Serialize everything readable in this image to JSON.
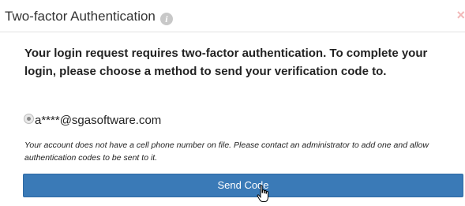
{
  "dialog": {
    "title": "Two-factor Authentication",
    "info_icon": "info-icon",
    "info_glyph": "i",
    "close_icon": "close-icon",
    "close_glyph": "×"
  },
  "body": {
    "message": "Your login request requires two-factor authentication. To complete your login, please choose a method to send your verification code to.",
    "method_option": {
      "label": "a****@sgasoftware.com",
      "selected": true
    },
    "notice": "Your account does not have a cell phone number on file. Please contact an administrator to add one and allow authentication codes to be sent to it.",
    "send_button_label": "Send Code"
  },
  "colors": {
    "button_background": "#3a7ab7",
    "close_icon": "#f2b8b8",
    "info_icon": "#c8c8c8"
  },
  "cursor_icon": "hand-pointer-icon"
}
